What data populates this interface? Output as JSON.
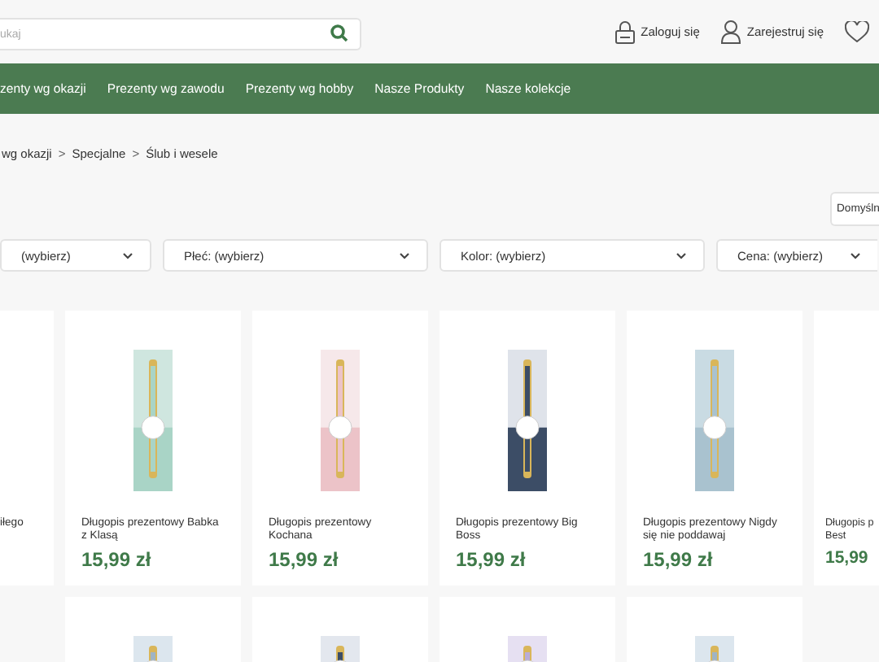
{
  "search": {
    "placeholder": "ukaj"
  },
  "account_links": [
    {
      "kind": "login",
      "label": "Zaloguj się"
    },
    {
      "kind": "register",
      "label": "Zarejestruj się"
    },
    {
      "kind": "wishlist"
    }
  ],
  "nav": [
    "zenty wg okazji",
    "Prezenty wg zawodu",
    "Prezenty wg hobby",
    "Nasze Produkty",
    "Nasze kolekcje"
  ],
  "breadcrumb": {
    "items": [
      "wg okazji",
      "Specjalne",
      "Ślub i wesele"
    ],
    "separator": ">"
  },
  "sort": {
    "value": "Domyśln"
  },
  "filters": [
    "(wybierz)",
    "Płeć: (wybierz)",
    "Kolor: (wybierz)",
    "Cena: (wybierz)"
  ],
  "products": [
    {
      "title": "iłego"
    },
    {
      "title": "Długopis prezentowy Babka z Klasą",
      "price": "15,99 zł"
    },
    {
      "title": "Długopis prezentowy Kochana",
      "price": "15,99 zł"
    },
    {
      "title": "Długopis prezentowy Big Boss",
      "price": "15,99 zł"
    },
    {
      "title": "Długopis prezentowy Nigdy się nie poddawaj",
      "price": "15,99 zł"
    },
    {
      "title": "Długopis p\nBest",
      "price": "15,99"
    }
  ]
}
